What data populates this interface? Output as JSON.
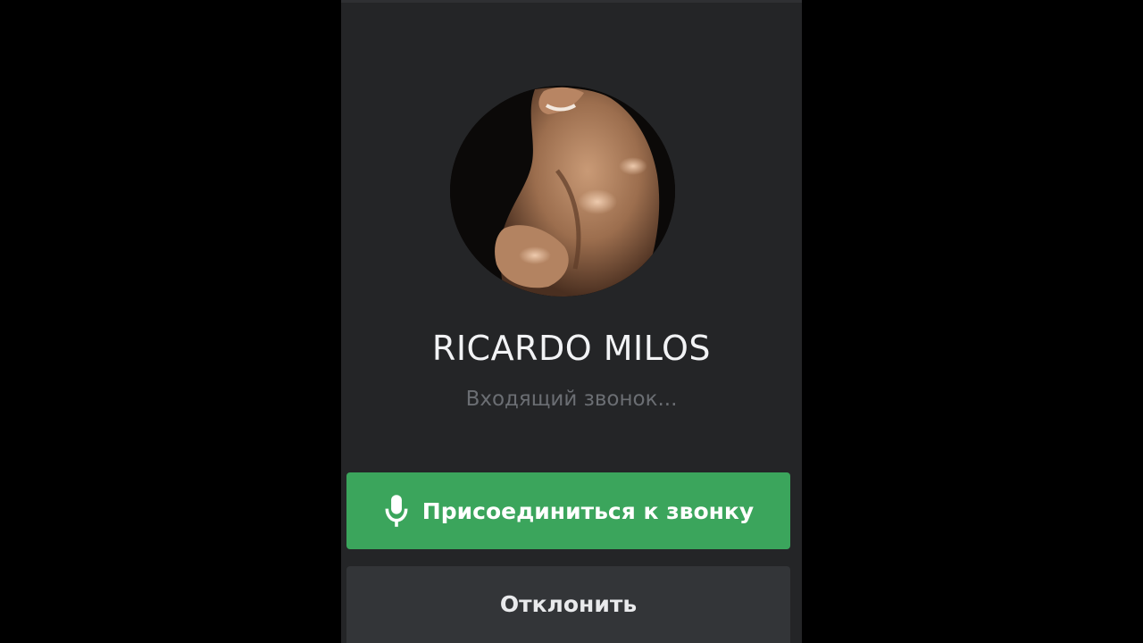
{
  "call": {
    "caller_name": "RICARDO MILOS",
    "status_text": "Входящий звонок...",
    "join_label": "Присоединиться к звонку",
    "decline_label": "Отклонить"
  },
  "icons": {
    "join_icon": "microphone-icon"
  },
  "colors": {
    "join_button": "#3ba55c",
    "decline_button": "#333538",
    "panel": "#242527",
    "backdrop": "#000000"
  }
}
